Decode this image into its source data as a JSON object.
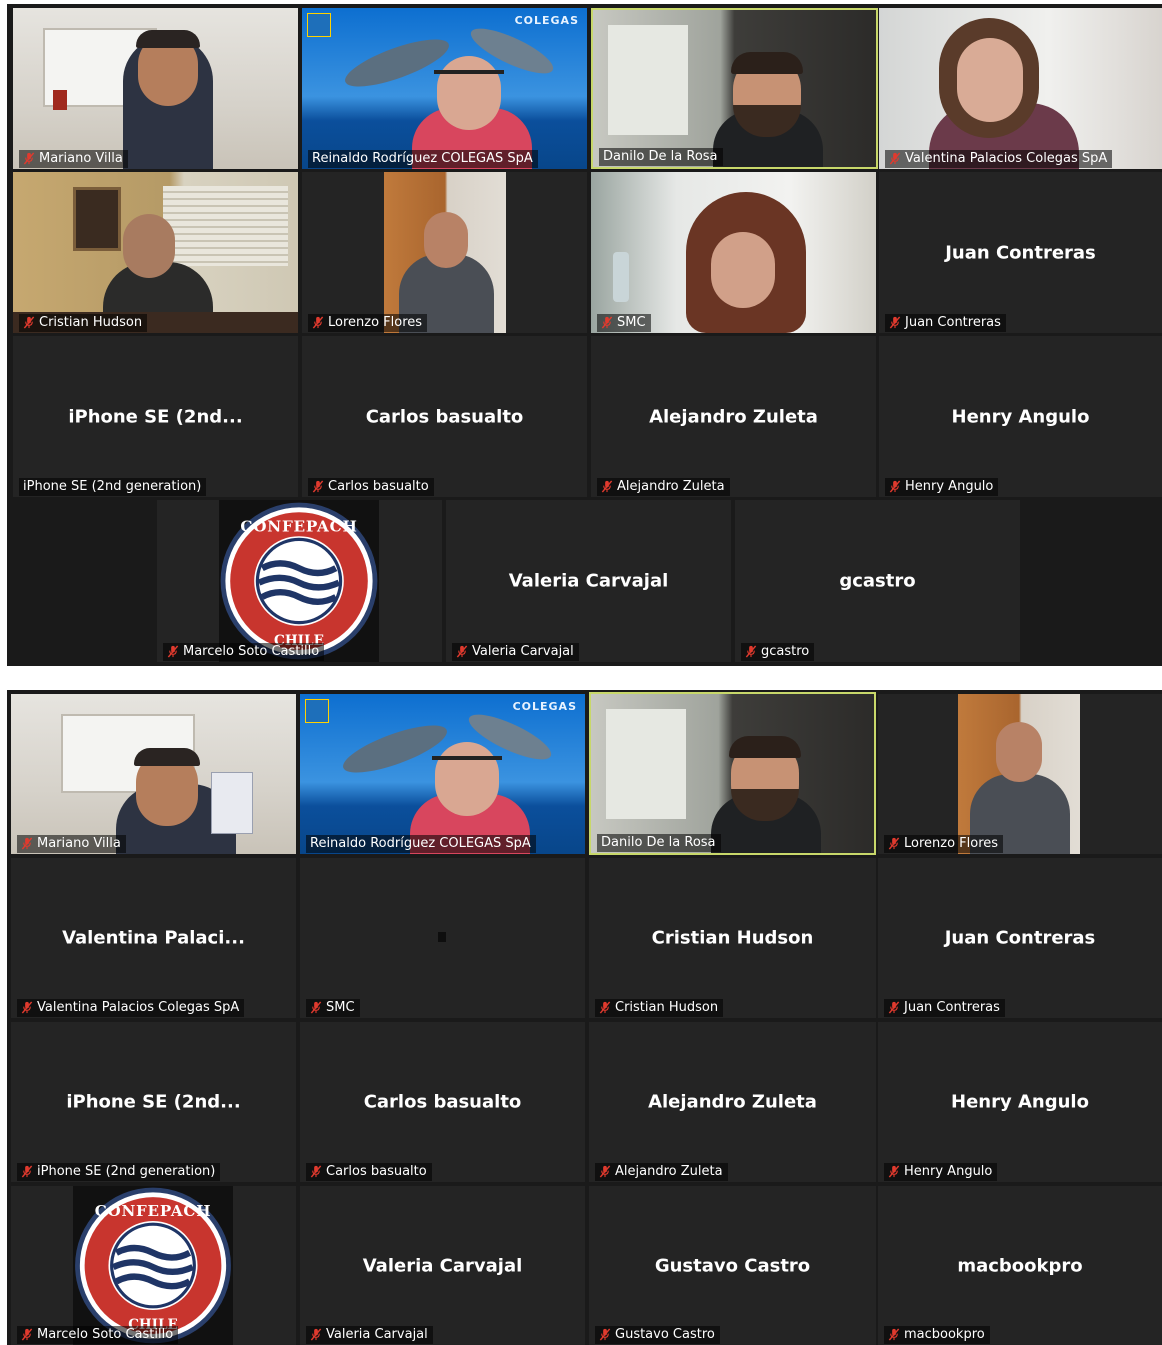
{
  "colors": {
    "tile_background": "#242424",
    "active_speaker_border": "#c8d86a",
    "muted_icon": "#e03a2e",
    "text": "#ffffff"
  },
  "panel1": {
    "tiles": [
      {
        "tag": "Mariano Villa",
        "muted": true,
        "video": "office-man-glasses"
      },
      {
        "tag": "Reinaldo Rodríguez  COLEGAS SpA",
        "muted": false,
        "video": "dolphin-background",
        "logo_text": "COLEGAS"
      },
      {
        "tag": "Danilo De la Rosa",
        "muted": false,
        "video": "bearded-man-glasses",
        "active": true
      },
      {
        "tag": "Valentina Palacios Colegas SpA",
        "muted": true,
        "video": "woman-window"
      },
      {
        "tag": "Cristian Hudson",
        "muted": true,
        "video": "man-office-blinds"
      },
      {
        "tag": "Lorenzo Flores",
        "muted": true,
        "video": "man-hand-on-chin"
      },
      {
        "tag": "SMC",
        "muted": true,
        "video": "woman-curly-hair"
      },
      {
        "tag": "Juan Contreras",
        "muted": true,
        "name": "Juan Contreras"
      },
      {
        "tag": "iPhone SE (2nd generation)",
        "muted": false,
        "name": "iPhone  SE  (2nd..."
      },
      {
        "tag": "Carlos basualto",
        "muted": true,
        "name": "Carlos basualto"
      },
      {
        "tag": "Alejandro Zuleta",
        "muted": true,
        "name": "Alejandro Zuleta"
      },
      {
        "tag": "Henry Angulo",
        "muted": true,
        "name": "Henry Angulo"
      },
      {
        "tag": "Marcelo Soto Castillo",
        "muted": true,
        "logo_top": "CONFEPACH",
        "logo_bottom": "CHILE"
      },
      {
        "tag": "Valeria Carvajal",
        "muted": true,
        "name": "Valeria Carvajal"
      },
      {
        "tag": "gcastro",
        "muted": true,
        "name": "gcastro"
      }
    ]
  },
  "panel2": {
    "tiles": [
      {
        "tag": "Mariano Villa",
        "muted": true,
        "video": "office-man-glasses"
      },
      {
        "tag": "Reinaldo Rodríguez  COLEGAS SpA",
        "muted": false,
        "video": "dolphin-background",
        "logo_text": "COLEGAS"
      },
      {
        "tag": "Danilo De la Rosa",
        "muted": false,
        "video": "bearded-man-glasses",
        "active": true
      },
      {
        "tag": "Lorenzo Flores",
        "muted": true,
        "video": "man-hand-on-chin"
      },
      {
        "tag": "Valentina Palacios Colegas SpA",
        "muted": true,
        "name": "Valentina  Palaci..."
      },
      {
        "tag": "SMC",
        "muted": true,
        "name": ""
      },
      {
        "tag": "Cristian Hudson",
        "muted": true,
        "name": "Cristian Hudson"
      },
      {
        "tag": "Juan Contreras",
        "muted": true,
        "name": "Juan Contreras"
      },
      {
        "tag": "iPhone SE (2nd generation)",
        "muted": true,
        "name": "iPhone  SE  (2nd..."
      },
      {
        "tag": "Carlos basualto",
        "muted": true,
        "name": "Carlos basualto"
      },
      {
        "tag": "Alejandro Zuleta",
        "muted": true,
        "name": "Alejandro Zuleta"
      },
      {
        "tag": "Henry Angulo",
        "muted": true,
        "name": "Henry Angulo"
      },
      {
        "tag": "Marcelo Soto Castillo",
        "muted": true,
        "logo_top": "CONFEPACH",
        "logo_bottom": "CHILE"
      },
      {
        "tag": "Valeria Carvajal",
        "muted": true,
        "name": "Valeria Carvajal"
      },
      {
        "tag": "Gustavo Castro",
        "muted": true,
        "name": "Gustavo Castro"
      },
      {
        "tag": "macbookpro",
        "muted": true,
        "name": "macbookpro"
      }
    ]
  }
}
